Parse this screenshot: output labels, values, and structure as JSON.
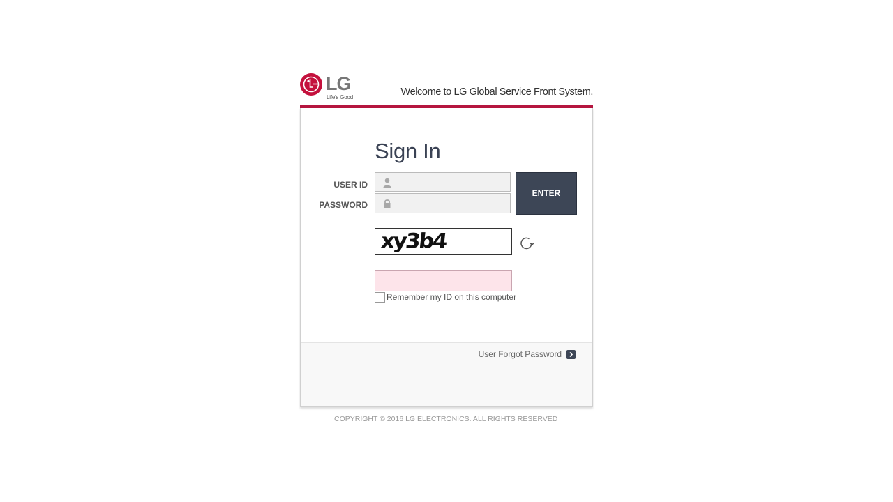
{
  "header": {
    "logo_word": "LG",
    "logo_tagline": "Life's Good",
    "welcome": "Welcome to LG Global Service Front System."
  },
  "signin": {
    "title": "Sign In",
    "user_id_label": "USER ID",
    "password_label": "PASSWORD",
    "user_id_value": "",
    "password_value": "",
    "enter_label": "ENTER",
    "captcha_text": "xy3b4",
    "captcha_value": "",
    "remember_label": "Remember my ID on this computer",
    "remember_checked": false
  },
  "footer": {
    "forgot_label": "User Forgot Password",
    "copyright": "COPYRIGHT © 2016 LG ELECTRONICS. ALL RIGHTS RESERVED"
  },
  "colors": {
    "brand_red": "#c4113d",
    "header_rule": "#b5153f",
    "button_dark": "#3d4656",
    "captcha_input_bg": "#fde4ea"
  },
  "icons": {
    "user_field": "user-icon",
    "password_field": "lock-icon",
    "captcha_refresh": "refresh-icon",
    "forgot_link": "chevron-right-icon"
  }
}
